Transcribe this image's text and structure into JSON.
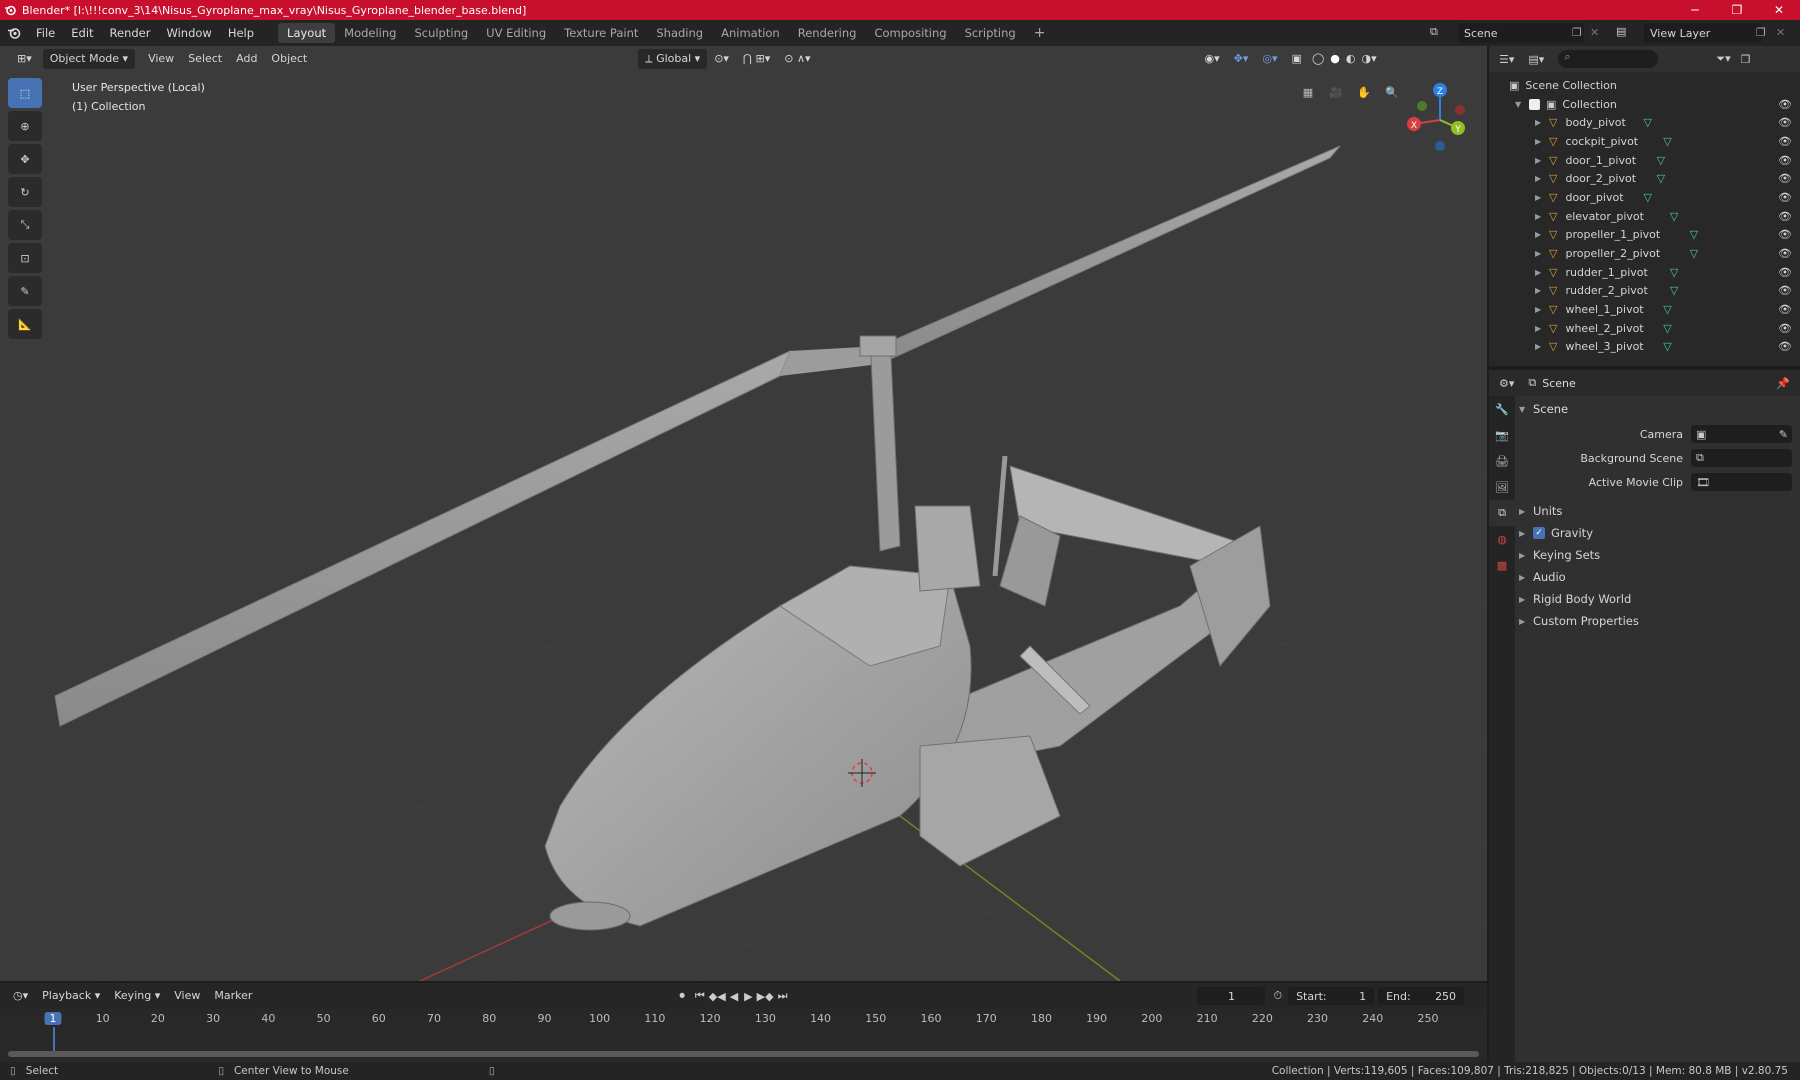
{
  "window": {
    "title": "Blender* [I:\\!!!conv_3\\14\\Nisus_Gyroplane_max_vray\\Nisus_Gyroplane_blender_base.blend]"
  },
  "menubar": {
    "items": [
      "File",
      "Edit",
      "Render",
      "Window",
      "Help"
    ],
    "workspaces": [
      "Layout",
      "Modeling",
      "Sculpting",
      "UV Editing",
      "Texture Paint",
      "Shading",
      "Animation",
      "Rendering",
      "Compositing",
      "Scripting"
    ],
    "active_workspace": "Layout",
    "scene": "Scene",
    "view_layer": "View Layer"
  },
  "viewport": {
    "mode": "Object Mode",
    "menus": [
      "View",
      "Select",
      "Add",
      "Object"
    ],
    "orientation": "Global",
    "perspective_label": "User Perspective (Local)",
    "collection_label": "(1) Collection",
    "gizmo": {
      "x": "X",
      "y": "Y",
      "z": "Z"
    }
  },
  "outliner": {
    "root": "Scene Collection",
    "collection": "Collection",
    "items": [
      "body_pivot",
      "cockpit_pivot",
      "door_1_pivot",
      "door_2_pivot",
      "door_pivot",
      "elevator_pivot",
      "propeller_1_pivot",
      "propeller_2_pivot",
      "rudder_1_pivot",
      "rudder_2_pivot",
      "wheel_1_pivot",
      "wheel_2_pivot",
      "wheel_3_pivot"
    ]
  },
  "properties": {
    "header": "Scene",
    "panel": "Scene",
    "fields": [
      {
        "label": "Camera",
        "value": ""
      },
      {
        "label": "Background Scene",
        "value": ""
      },
      {
        "label": "Active Movie Clip",
        "value": ""
      }
    ],
    "subpanels": [
      "Units",
      "Gravity",
      "Keying Sets",
      "Audio",
      "Rigid Body World",
      "Custom Properties"
    ],
    "gravity_checked": true
  },
  "timeline": {
    "menus": [
      "Playback",
      "Keying",
      "View",
      "Marker"
    ],
    "current_frame": "1",
    "start_label": "Start:",
    "start": "1",
    "end_label": "End:",
    "end": "250",
    "ticks": [
      "1",
      "10",
      "20",
      "30",
      "40",
      "50",
      "60",
      "70",
      "80",
      "90",
      "100",
      "110",
      "120",
      "130",
      "140",
      "150",
      "160",
      "170",
      "180",
      "190",
      "200",
      "210",
      "220",
      "230",
      "240",
      "250"
    ]
  },
  "statusbar": {
    "select": "Select",
    "center_view": "Center View to Mouse",
    "stats": "Collection | Verts:119,605 | Faces:109,807 | Tris:218,825 | Objects:0/13 | Mem: 80.8 MB | v2.80.75"
  },
  "colors": {
    "titlebar": "#c8102e",
    "accent": "#4772b3",
    "viewport_bg": "#3b3b3b"
  }
}
